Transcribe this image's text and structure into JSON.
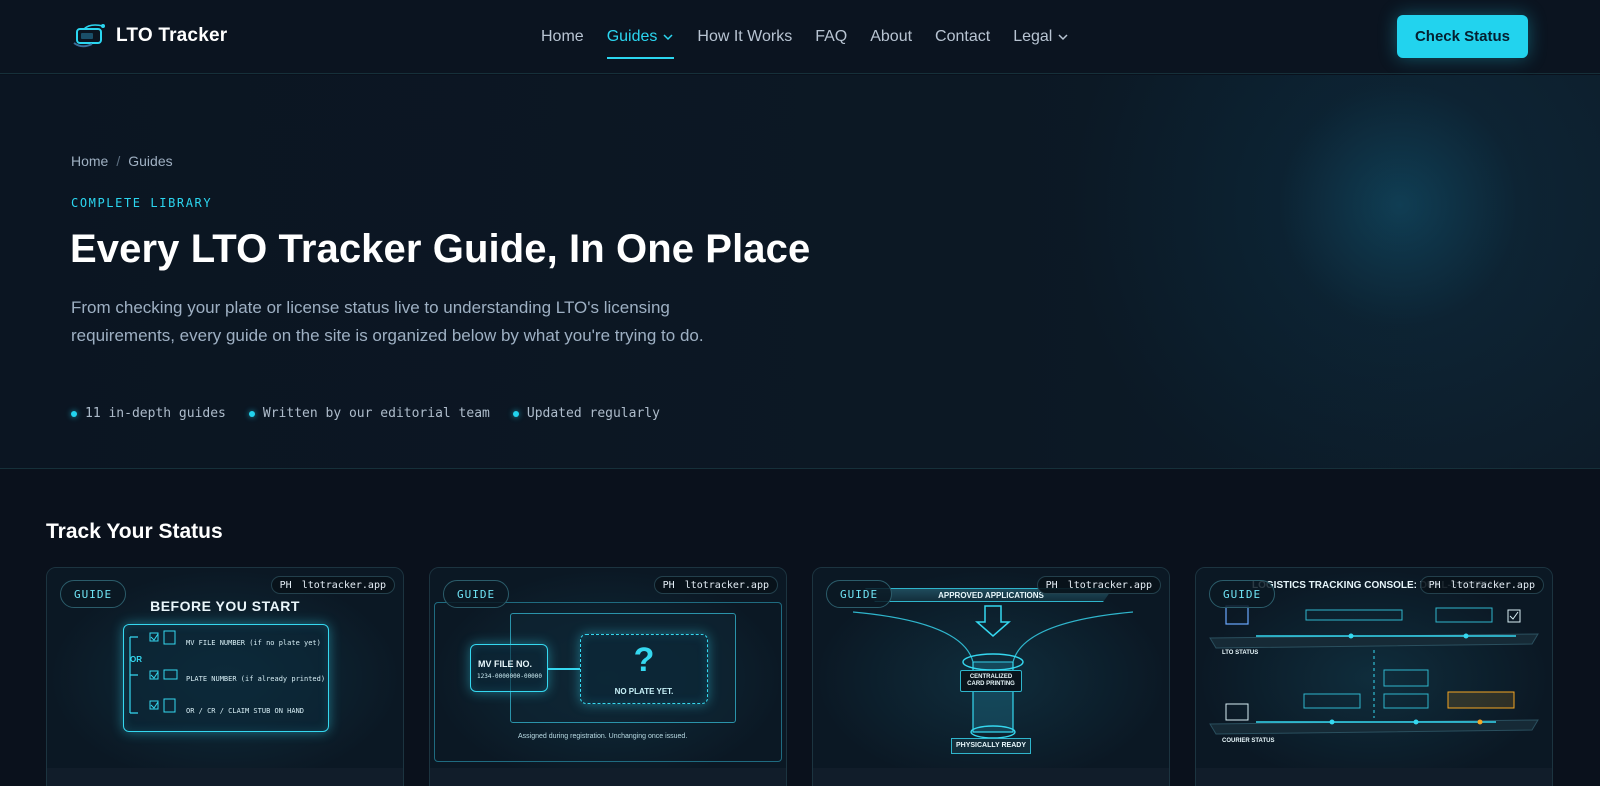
{
  "brand": {
    "name": "LTO Tracker"
  },
  "nav": {
    "items": [
      {
        "label": "Home"
      },
      {
        "label": "Guides"
      },
      {
        "label": "How It Works"
      },
      {
        "label": "FAQ"
      },
      {
        "label": "About"
      },
      {
        "label": "Contact"
      },
      {
        "label": "Legal"
      }
    ],
    "active": "Guides",
    "cta_label": "Check Status"
  },
  "breadcrumb": {
    "home": "Home",
    "separator": "/",
    "current": "Guides"
  },
  "hero": {
    "eyebrow": "COMPLETE LIBRARY",
    "title": "Every LTO Tracker Guide, In One Place",
    "description": "From checking your plate or license status live to understanding LTO's licensing requirements, every guide on the site is organized below by what you're trying to do.",
    "bullets": [
      "11 in-depth guides",
      "Written by our editorial team",
      "Updated regularly"
    ]
  },
  "section": {
    "title": "Track Your Status"
  },
  "cards": [
    {
      "badge": "GUIDE",
      "watermark_country": "PH",
      "watermark_site": "ltotracker.app",
      "image_title": "BEFORE YOU START",
      "items": [
        "MV FILE NUMBER (if no plate yet)",
        "PLATE NUMBER (if already printed)",
        "OR / CR / CLAIM STUB ON HAND"
      ],
      "or_label": "OR"
    },
    {
      "badge": "GUIDE",
      "watermark_country": "PH",
      "watermark_site": "ltotracker.app",
      "mv_label": "MV FILE NO.",
      "mv_number": "1234-0000000-00000",
      "question_mark": "?",
      "plate_label": "NO PLATE YET.",
      "caption": "Assigned during registration. Unchanging once issued."
    },
    {
      "badge": "GUIDE",
      "watermark_country": "PH",
      "watermark_site": "ltotracker.app",
      "top_label": "APPROVED APPLICATIONS",
      "mid_label": "CENTRALIZED CARD PRINTING",
      "bottom_label": "PHYSICALLY READY"
    },
    {
      "badge": "GUIDE",
      "watermark_country": "PH",
      "watermark_site": "ltotracker.app",
      "header_text": "LOGISTICS TRACKING CONSOLE: DUAL-SYSTEM A",
      "row1_label": "LTO STATUS",
      "row2_label": "COURIER STATUS"
    }
  ],
  "colors": {
    "accent": "#22d3ee",
    "background": "#0a111c",
    "header": "#0b1420"
  }
}
